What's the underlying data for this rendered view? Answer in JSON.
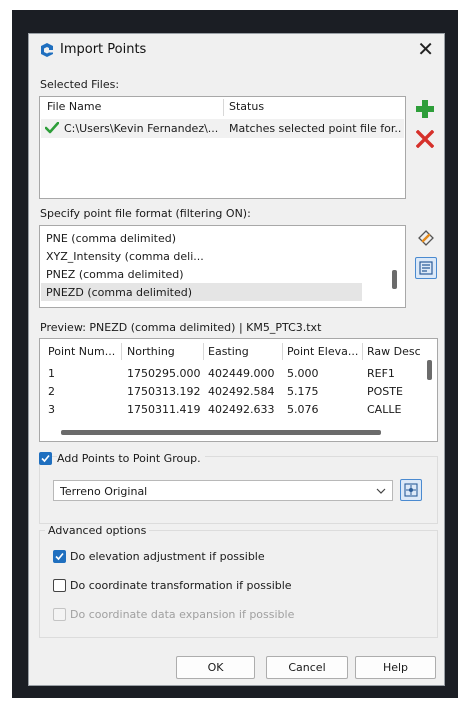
{
  "dialog": {
    "title": "Import Points",
    "close_glyph": "✕"
  },
  "selected_files": {
    "label": "Selected Files:",
    "columns": [
      "File Name",
      "Status"
    ],
    "rows": [
      {
        "file": "C:\\Users\\Kevin Fernandez\\...",
        "status": "Matches selected point file for..."
      }
    ]
  },
  "format": {
    "label": "Specify point file format (filtering ON):",
    "items": [
      "PNE (comma delimited)",
      "XYZ_Intensity (comma deli...",
      "PNEZ (comma delimited)",
      "PNEZD (comma delimited)"
    ],
    "selected": "PNEZD (comma delimited)"
  },
  "preview": {
    "label": "Preview: PNEZD (comma delimited) | KM5_PTC3.txt",
    "columns": [
      "Point Num...",
      "Northing",
      "Easting",
      "Point Eleva...",
      "Raw Desc"
    ],
    "rows": [
      [
        "1",
        "1750295.000",
        "402449.000",
        "5.000",
        "REF1"
      ],
      [
        "2",
        "1750313.192",
        "402492.584",
        "5.175",
        "POSTE"
      ],
      [
        "3",
        "1750311.419",
        "402492.633",
        "5.076",
        "CALLE"
      ]
    ]
  },
  "point_group": {
    "checkbox_label": "Add Points to Point Group.",
    "checked": true,
    "selected_value": "Terreno Original"
  },
  "advanced": {
    "label": "Advanced options",
    "options": [
      {
        "label": "Do elevation adjustment if possible",
        "checked": true,
        "enabled": true
      },
      {
        "label": "Do coordinate transformation if possible",
        "checked": false,
        "enabled": true
      },
      {
        "label": "Do coordinate data expansion if possible",
        "checked": false,
        "enabled": false
      }
    ]
  },
  "buttons": {
    "ok": "OK",
    "cancel": "Cancel",
    "help": "Help"
  },
  "colors": {
    "accent": "#1f6fbf",
    "add_green": "#2e9e3a",
    "remove_red": "#d6312b",
    "check_green": "#2e9e3a"
  }
}
